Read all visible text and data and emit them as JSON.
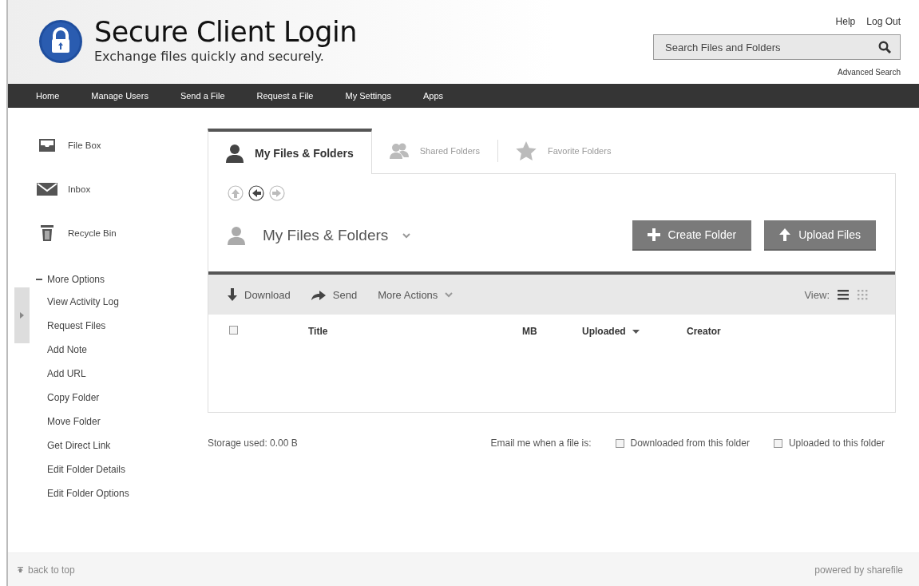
{
  "header": {
    "title": "Secure Client Login",
    "tagline": "Exchange files quickly and securely.",
    "links": [
      "Help",
      "Log Out"
    ],
    "search": {
      "placeholder": "Search Files and Folders"
    },
    "advanced_search": "Advanced Search"
  },
  "nav": [
    "Home",
    "Manage Users",
    "Send a File",
    "Request a File",
    "My Settings",
    "Apps"
  ],
  "sidebar": {
    "items": [
      {
        "label": "File Box",
        "kind": "tray"
      },
      {
        "label": "Inbox",
        "kind": "mail"
      },
      {
        "label": "Recycle Bin",
        "kind": "trash"
      }
    ],
    "more_options": {
      "label": "More Options",
      "expanded": true,
      "items": [
        "View Activity Log",
        "Request Files",
        "Add Note",
        "Add URL",
        "Copy Folder",
        "Move Folder",
        "Get Direct Link",
        "Edit Folder Details",
        "Edit Folder Options"
      ]
    }
  },
  "tabs": [
    {
      "label": "My Files & Folders",
      "kind": "person",
      "selected": true
    },
    {
      "label": "Shared Folders",
      "kind": "people",
      "selected": false
    },
    {
      "label": "Favorite Folders",
      "kind": "star",
      "selected": false
    }
  ],
  "folder_nav": [
    {
      "kind": "up",
      "disabled": true
    },
    {
      "kind": "back",
      "disabled": false
    },
    {
      "kind": "forward",
      "disabled": true
    }
  ],
  "folder_title": "My Files & Folders",
  "buttons": [
    {
      "label": "Create Folder",
      "kind": "plus"
    },
    {
      "label": "Upload Files",
      "kind": "up"
    }
  ],
  "toolbar": {
    "actions": [
      {
        "label": "Download",
        "kind": "down"
      },
      {
        "label": "Send",
        "kind": "send"
      },
      {
        "label": "More Actions",
        "kind": "caret"
      }
    ],
    "view_label": "View:",
    "views": [
      {
        "kind": "list",
        "selected": true
      },
      {
        "kind": "grid",
        "selected": false
      }
    ]
  },
  "table": {
    "select_all": {
      "checked": false
    },
    "columns": [
      {
        "label": "Title",
        "sorted": false
      },
      {
        "label": "MB",
        "sorted": false
      },
      {
        "label": "Uploaded",
        "sorted": true
      },
      {
        "label": "Creator",
        "sorted": false
      }
    ]
  },
  "storage": "Storage used: 0.00 B",
  "email": {
    "label": "Email me when a file is:",
    "options": [
      {
        "label": "Downloaded from this folder",
        "checked": false
      },
      {
        "label": "Uploaded to this folder",
        "checked": false
      }
    ]
  },
  "footer": {
    "back_to_top": "back to top",
    "powered_by": "powered by sharefile"
  }
}
